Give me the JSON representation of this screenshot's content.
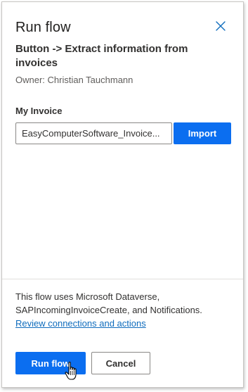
{
  "panel": {
    "title": "Run flow",
    "subtitle": "Button -> Extract information from invoices",
    "owner": "Owner: Christian Tauchmann"
  },
  "form": {
    "field_label": "My Invoice",
    "field_value": "EasyComputerSoftware_Invoice...",
    "import_label": "Import"
  },
  "footer": {
    "info_text": "This flow uses Microsoft Dataverse, SAPIncomingInvoiceCreate, and Notifications.",
    "review_link": "Review connections and actions",
    "run_label": "Run flow",
    "cancel_label": "Cancel"
  },
  "colors": {
    "accent": "#0b6ef0",
    "link": "#0f6cbd",
    "close_icon": "#0f6cbd"
  },
  "icons": {
    "close": "close-icon",
    "cursor": "hand-pointer-icon"
  }
}
